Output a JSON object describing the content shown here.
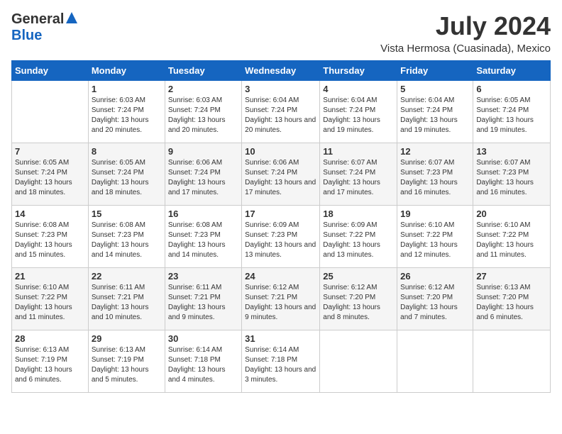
{
  "header": {
    "logo_general": "General",
    "logo_blue": "Blue",
    "month_year": "July 2024",
    "location": "Vista Hermosa (Cuasinada), Mexico"
  },
  "days_of_week": [
    "Sunday",
    "Monday",
    "Tuesday",
    "Wednesday",
    "Thursday",
    "Friday",
    "Saturday"
  ],
  "weeks": [
    [
      {
        "day": "",
        "sunrise": "",
        "sunset": "",
        "daylight": ""
      },
      {
        "day": "1",
        "sunrise": "Sunrise: 6:03 AM",
        "sunset": "Sunset: 7:24 PM",
        "daylight": "Daylight: 13 hours and 20 minutes."
      },
      {
        "day": "2",
        "sunrise": "Sunrise: 6:03 AM",
        "sunset": "Sunset: 7:24 PM",
        "daylight": "Daylight: 13 hours and 20 minutes."
      },
      {
        "day": "3",
        "sunrise": "Sunrise: 6:04 AM",
        "sunset": "Sunset: 7:24 PM",
        "daylight": "Daylight: 13 hours and 20 minutes."
      },
      {
        "day": "4",
        "sunrise": "Sunrise: 6:04 AM",
        "sunset": "Sunset: 7:24 PM",
        "daylight": "Daylight: 13 hours and 19 minutes."
      },
      {
        "day": "5",
        "sunrise": "Sunrise: 6:04 AM",
        "sunset": "Sunset: 7:24 PM",
        "daylight": "Daylight: 13 hours and 19 minutes."
      },
      {
        "day": "6",
        "sunrise": "Sunrise: 6:05 AM",
        "sunset": "Sunset: 7:24 PM",
        "daylight": "Daylight: 13 hours and 19 minutes."
      }
    ],
    [
      {
        "day": "7",
        "sunrise": "Sunrise: 6:05 AM",
        "sunset": "Sunset: 7:24 PM",
        "daylight": "Daylight: 13 hours and 18 minutes."
      },
      {
        "day": "8",
        "sunrise": "Sunrise: 6:05 AM",
        "sunset": "Sunset: 7:24 PM",
        "daylight": "Daylight: 13 hours and 18 minutes."
      },
      {
        "day": "9",
        "sunrise": "Sunrise: 6:06 AM",
        "sunset": "Sunset: 7:24 PM",
        "daylight": "Daylight: 13 hours and 17 minutes."
      },
      {
        "day": "10",
        "sunrise": "Sunrise: 6:06 AM",
        "sunset": "Sunset: 7:24 PM",
        "daylight": "Daylight: 13 hours and 17 minutes."
      },
      {
        "day": "11",
        "sunrise": "Sunrise: 6:07 AM",
        "sunset": "Sunset: 7:24 PM",
        "daylight": "Daylight: 13 hours and 17 minutes."
      },
      {
        "day": "12",
        "sunrise": "Sunrise: 6:07 AM",
        "sunset": "Sunset: 7:23 PM",
        "daylight": "Daylight: 13 hours and 16 minutes."
      },
      {
        "day": "13",
        "sunrise": "Sunrise: 6:07 AM",
        "sunset": "Sunset: 7:23 PM",
        "daylight": "Daylight: 13 hours and 16 minutes."
      }
    ],
    [
      {
        "day": "14",
        "sunrise": "Sunrise: 6:08 AM",
        "sunset": "Sunset: 7:23 PM",
        "daylight": "Daylight: 13 hours and 15 minutes."
      },
      {
        "day": "15",
        "sunrise": "Sunrise: 6:08 AM",
        "sunset": "Sunset: 7:23 PM",
        "daylight": "Daylight: 13 hours and 14 minutes."
      },
      {
        "day": "16",
        "sunrise": "Sunrise: 6:08 AM",
        "sunset": "Sunset: 7:23 PM",
        "daylight": "Daylight: 13 hours and 14 minutes."
      },
      {
        "day": "17",
        "sunrise": "Sunrise: 6:09 AM",
        "sunset": "Sunset: 7:23 PM",
        "daylight": "Daylight: 13 hours and 13 minutes."
      },
      {
        "day": "18",
        "sunrise": "Sunrise: 6:09 AM",
        "sunset": "Sunset: 7:22 PM",
        "daylight": "Daylight: 13 hours and 13 minutes."
      },
      {
        "day": "19",
        "sunrise": "Sunrise: 6:10 AM",
        "sunset": "Sunset: 7:22 PM",
        "daylight": "Daylight: 13 hours and 12 minutes."
      },
      {
        "day": "20",
        "sunrise": "Sunrise: 6:10 AM",
        "sunset": "Sunset: 7:22 PM",
        "daylight": "Daylight: 13 hours and 11 minutes."
      }
    ],
    [
      {
        "day": "21",
        "sunrise": "Sunrise: 6:10 AM",
        "sunset": "Sunset: 7:22 PM",
        "daylight": "Daylight: 13 hours and 11 minutes."
      },
      {
        "day": "22",
        "sunrise": "Sunrise: 6:11 AM",
        "sunset": "Sunset: 7:21 PM",
        "daylight": "Daylight: 13 hours and 10 minutes."
      },
      {
        "day": "23",
        "sunrise": "Sunrise: 6:11 AM",
        "sunset": "Sunset: 7:21 PM",
        "daylight": "Daylight: 13 hours and 9 minutes."
      },
      {
        "day": "24",
        "sunrise": "Sunrise: 6:12 AM",
        "sunset": "Sunset: 7:21 PM",
        "daylight": "Daylight: 13 hours and 9 minutes."
      },
      {
        "day": "25",
        "sunrise": "Sunrise: 6:12 AM",
        "sunset": "Sunset: 7:20 PM",
        "daylight": "Daylight: 13 hours and 8 minutes."
      },
      {
        "day": "26",
        "sunrise": "Sunrise: 6:12 AM",
        "sunset": "Sunset: 7:20 PM",
        "daylight": "Daylight: 13 hours and 7 minutes."
      },
      {
        "day": "27",
        "sunrise": "Sunrise: 6:13 AM",
        "sunset": "Sunset: 7:20 PM",
        "daylight": "Daylight: 13 hours and 6 minutes."
      }
    ],
    [
      {
        "day": "28",
        "sunrise": "Sunrise: 6:13 AM",
        "sunset": "Sunset: 7:19 PM",
        "daylight": "Daylight: 13 hours and 6 minutes."
      },
      {
        "day": "29",
        "sunrise": "Sunrise: 6:13 AM",
        "sunset": "Sunset: 7:19 PM",
        "daylight": "Daylight: 13 hours and 5 minutes."
      },
      {
        "day": "30",
        "sunrise": "Sunrise: 6:14 AM",
        "sunset": "Sunset: 7:18 PM",
        "daylight": "Daylight: 13 hours and 4 minutes."
      },
      {
        "day": "31",
        "sunrise": "Sunrise: 6:14 AM",
        "sunset": "Sunset: 7:18 PM",
        "daylight": "Daylight: 13 hours and 3 minutes."
      },
      {
        "day": "",
        "sunrise": "",
        "sunset": "",
        "daylight": ""
      },
      {
        "day": "",
        "sunrise": "",
        "sunset": "",
        "daylight": ""
      },
      {
        "day": "",
        "sunrise": "",
        "sunset": "",
        "daylight": ""
      }
    ]
  ]
}
